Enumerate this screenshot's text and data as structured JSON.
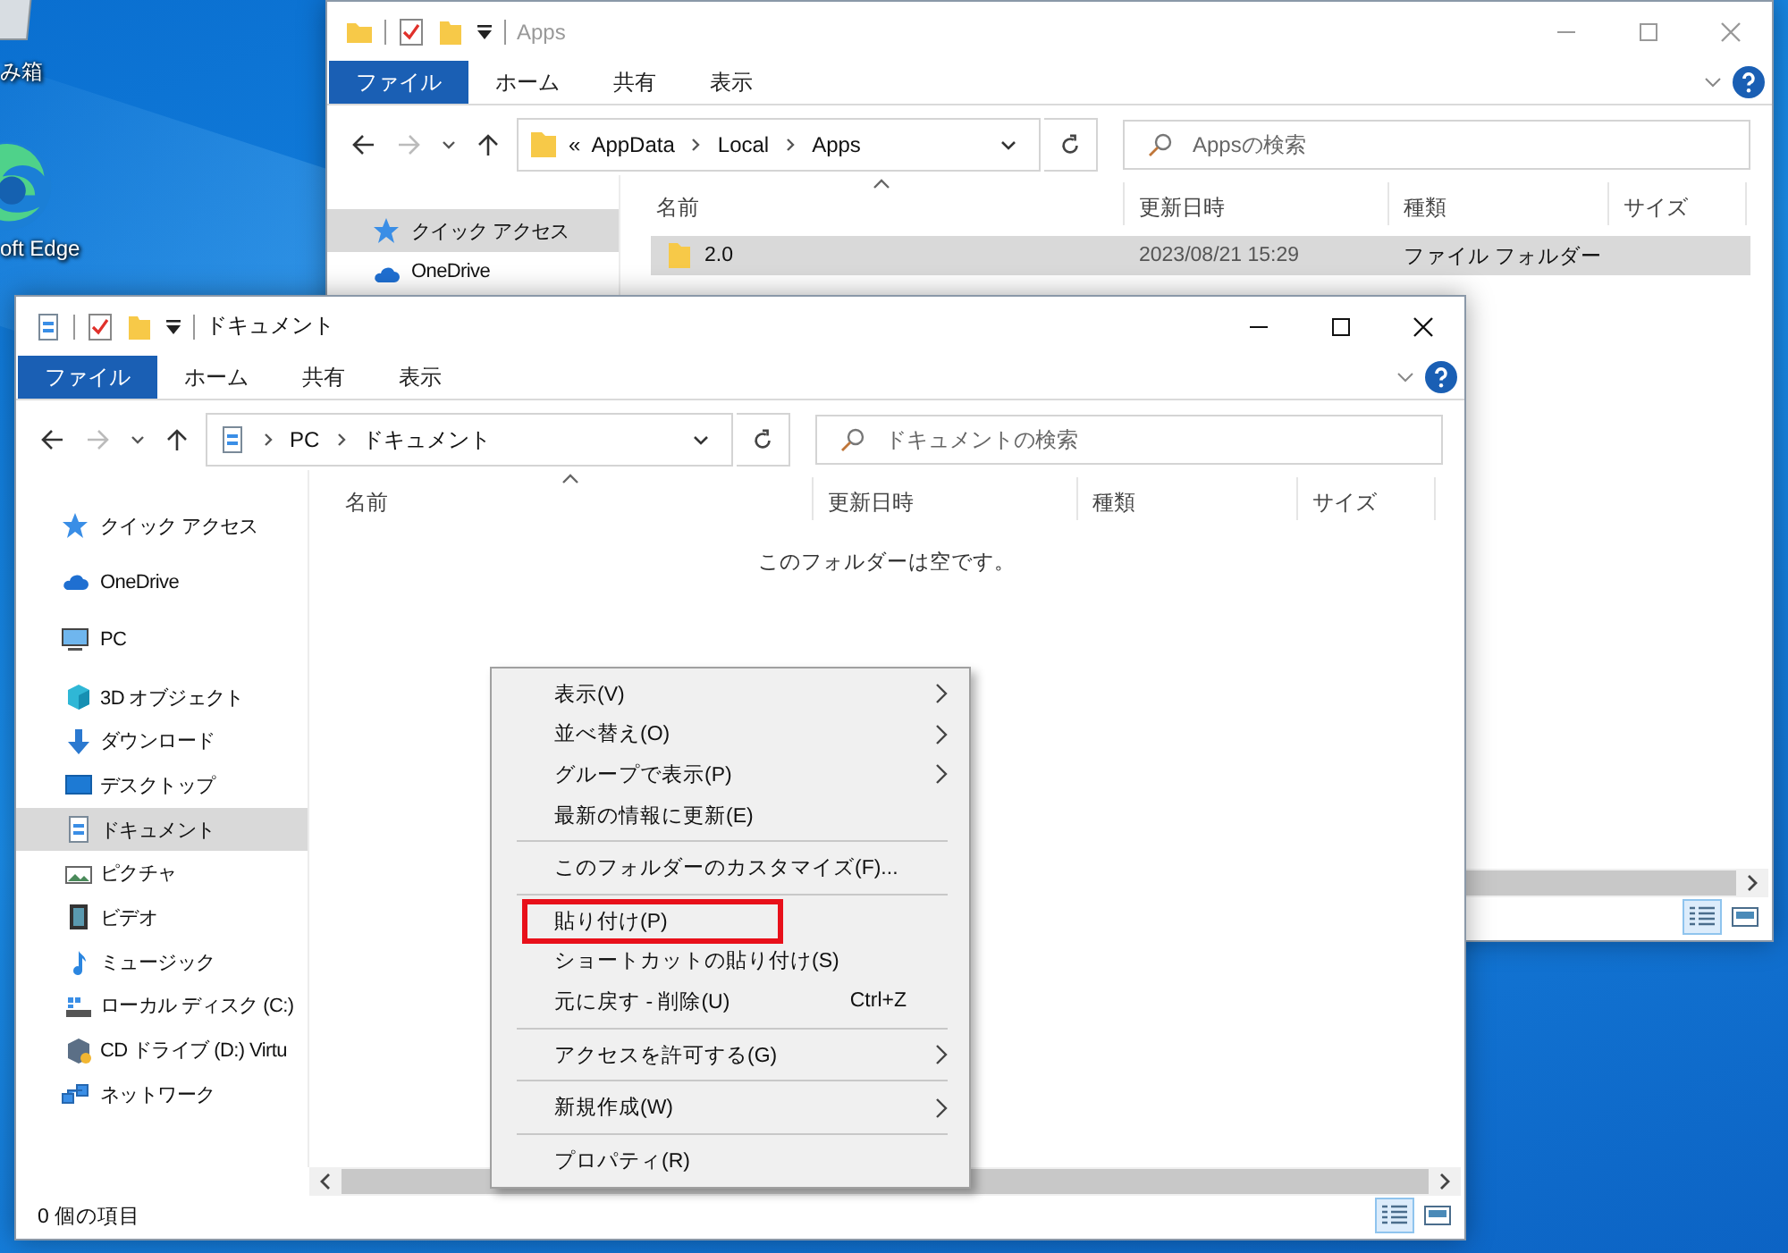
{
  "desktop_icons": [
    {
      "label": "み箱",
      "kind": "bin"
    },
    {
      "label": "oft Edge",
      "kind": "browser"
    }
  ],
  "windows": [
    {
      "title": "Apps",
      "active": false,
      "kind": "folder",
      "ribbon_tabs": [
        {
          "label": "ファイル",
          "selected": true
        },
        {
          "label": "ホーム",
          "selected": false
        },
        {
          "label": "共有",
          "selected": false
        },
        {
          "label": "表示",
          "selected": false
        }
      ],
      "address": {
        "kind": "folder",
        "overflow_mark": "«",
        "segments": [
          "AppData",
          "Local",
          "Apps"
        ]
      },
      "search": {
        "placeholder": "Appsの検索"
      },
      "nav_items": [
        {
          "label": "クイック アクセス",
          "kind": "star",
          "selected": true
        },
        {
          "label": "OneDrive",
          "kind": "cloud",
          "selected": false
        }
      ],
      "columns": [
        "名前",
        "更新日時",
        "種類",
        "サイズ"
      ],
      "rows": [
        {
          "name": "2.0",
          "modified": "2023/08/21 15:29",
          "type": "ファイル フォルダー",
          "selected": true
        }
      ],
      "view_modes": [
        {
          "kind": "details",
          "selected": true
        },
        {
          "kind": "large_icons",
          "selected": false
        }
      ]
    },
    {
      "title": "ドキュメント",
      "active": true,
      "kind": "document",
      "ribbon_tabs": [
        {
          "label": "ファイル",
          "selected": true
        },
        {
          "label": "ホーム",
          "selected": false
        },
        {
          "label": "共有",
          "selected": false
        },
        {
          "label": "表示",
          "selected": false
        }
      ],
      "address": {
        "kind": "document",
        "segments": [
          "PC",
          "ドキュメント"
        ]
      },
      "search": {
        "placeholder": "ドキュメントの検索"
      },
      "nav_items": [
        {
          "label": "クイック アクセス",
          "kind": "star",
          "selected": false
        },
        {
          "label": "OneDrive",
          "kind": "cloud",
          "selected": false
        },
        {
          "label": "PC",
          "kind": "pc",
          "selected": false,
          "children": [
            {
              "label": "3D オブジェクト",
              "kind": "cube",
              "selected": false
            },
            {
              "label": "ダウンロード",
              "kind": "download",
              "selected": false
            },
            {
              "label": "デスクトップ",
              "kind": "desktop",
              "selected": false
            },
            {
              "label": "ドキュメント",
              "kind": "document",
              "selected": true
            },
            {
              "label": "ピクチャ",
              "kind": "picture",
              "selected": false
            },
            {
              "label": "ビデオ",
              "kind": "video",
              "selected": false
            },
            {
              "label": "ミュージック",
              "kind": "music",
              "selected": false
            },
            {
              "label": "ローカル ディスク (C:)",
              "kind": "disk",
              "selected": false
            },
            {
              "label": "CD ドライブ (D:) Virtu",
              "kind": "cd",
              "selected": false
            }
          ]
        },
        {
          "label": "ネットワーク",
          "kind": "network",
          "selected": false
        }
      ],
      "columns": [
        "名前",
        "更新日時",
        "種類",
        "サイズ"
      ],
      "empty_message": "このフォルダーは空です。",
      "status": "0 個の項目",
      "view_modes": [
        {
          "kind": "details",
          "selected": true
        },
        {
          "kind": "large_icons",
          "selected": false
        }
      ]
    }
  ],
  "context_menu": {
    "items": [
      {
        "kind": "item",
        "label": "表示(V)",
        "submenu": true,
        "highlighted": false
      },
      {
        "kind": "item",
        "label": "並べ替え(O)",
        "submenu": true,
        "highlighted": false
      },
      {
        "kind": "item",
        "label": "グループで表示(P)",
        "submenu": true,
        "highlighted": false
      },
      {
        "kind": "item",
        "label": "最新の情報に更新(E)",
        "submenu": false,
        "highlighted": false
      },
      {
        "kind": "separator"
      },
      {
        "kind": "item",
        "label": "このフォルダーのカスタマイズ(F)...",
        "submenu": false,
        "highlighted": false
      },
      {
        "kind": "separator"
      },
      {
        "kind": "item",
        "label": "貼り付け(P)",
        "submenu": false,
        "highlighted": true
      },
      {
        "kind": "item",
        "label": "ショートカットの貼り付け(S)",
        "submenu": false,
        "highlighted": false
      },
      {
        "kind": "item",
        "label": "元に戻す - 削除(U)",
        "shortcut": "Ctrl+Z",
        "submenu": false,
        "highlighted": false
      },
      {
        "kind": "separator"
      },
      {
        "kind": "item",
        "label": "アクセスを許可する(G)",
        "submenu": true,
        "highlighted": false
      },
      {
        "kind": "separator"
      },
      {
        "kind": "item",
        "label": "新規作成(W)",
        "submenu": true,
        "highlighted": false
      },
      {
        "kind": "separator"
      },
      {
        "kind": "item",
        "label": "プロパティ(R)",
        "submenu": false,
        "highlighted": false
      }
    ]
  }
}
